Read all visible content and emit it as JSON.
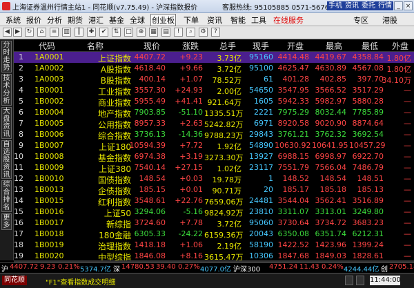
{
  "window": {
    "title": "上海证券温州行情主站1 - 同花顺(v7.75.49) - 沪深指数报价",
    "hotline": "客服热线: 95105885 0571-56768888",
    "top_buttons": [
      "手机",
      "资讯",
      "委托",
      "行情"
    ]
  },
  "menu": {
    "items": [
      "系统",
      "报价",
      "分析",
      "期货",
      "港汇",
      "基金",
      "全球",
      "创业板",
      "下单",
      "资讯",
      "智能",
      "工具",
      "在线服务"
    ],
    "selected": "创业板",
    "highlight": "在线服务",
    "right_items": [
      "专区",
      "港股"
    ]
  },
  "sidebar": {
    "tabs": [
      "分时走势",
      "技术分析",
      "大盘资讯",
      "自选股资讯",
      "综合排名",
      "更多"
    ]
  },
  "table": {
    "headers": [
      "代码",
      "名称",
      "现价",
      "涨跌",
      "总手",
      "现手",
      "开盘",
      "最高",
      "最低",
      "外盘"
    ],
    "rows": [
      {
        "no": "1",
        "code": "1A0001",
        "name": "上证指数",
        "price": "4407.72",
        "chg": "+9.23",
        "vol": "3.73亿",
        "cur": "95160",
        "open": "4414.48",
        "high": "4419.67",
        "low": "4358.84",
        "out": "1.80亿",
        "dir": "up"
      },
      {
        "no": "2",
        "code": "1A0002",
        "name": "A股指数",
        "price": "4618.40",
        "chg": "+9.66",
        "vol": "3.72亿",
        "cur": "95100",
        "open": "4625.47",
        "high": "4630.89",
        "low": "4567.08",
        "out": "1.80亿",
        "dir": "up"
      },
      {
        "no": "3",
        "code": "1A0003",
        "name": "B股指数",
        "price": "400.14",
        "chg": "+1.07",
        "vol": "78.52万",
        "cur": "61",
        "open": "401.28",
        "high": "402.85",
        "low": "397.70",
        "out": "34.10万",
        "dir": "up"
      },
      {
        "no": "4",
        "code": "1B0001",
        "name": "工业指数",
        "price": "3557.30",
        "chg": "+24.93",
        "vol": "2.00亿",
        "cur": "54650",
        "open": "3547.95",
        "high": "3566.52",
        "low": "3517.29",
        "out": "—",
        "dir": "up"
      },
      {
        "no": "5",
        "code": "1B0002",
        "name": "商业指数",
        "price": "5955.49",
        "chg": "+41.41",
        "vol": "921.64万",
        "cur": "1605",
        "open": "5942.33",
        "high": "5982.97",
        "low": "5880.28",
        "out": "—",
        "dir": "up"
      },
      {
        "no": "6",
        "code": "1B0004",
        "name": "地产指数",
        "price": "7903.85",
        "chg": "-51.10",
        "vol": "1335.51万",
        "cur": "2221",
        "open": "7975.29",
        "high": "8032.44",
        "low": "7785.89",
        "out": "—",
        "dir": "dn"
      },
      {
        "no": "7",
        "code": "1B0005",
        "name": "公用指数",
        "price": "8957.33",
        "chg": "+2.63",
        "vol": "5242.82万",
        "cur": "6971",
        "open": "8920.58",
        "high": "9020.90",
        "low": "8874.64",
        "out": "—",
        "dir": "up"
      },
      {
        "no": "8",
        "code": "1B0006",
        "name": "综合指数",
        "price": "3736.13",
        "chg": "-14.36",
        "vol": "9788.23万",
        "cur": "29843",
        "open": "3761.21",
        "high": "3762.32",
        "low": "3692.54",
        "out": "—",
        "dir": "dn"
      },
      {
        "no": "9",
        "code": "1B0007",
        "name": "上证180",
        "price": "10594.39",
        "chg": "+7.72",
        "vol": "1.92亿",
        "cur": "54890",
        "open": "10630.92",
        "high": "10641.95",
        "low": "10457.29",
        "out": "—",
        "dir": "up"
      },
      {
        "no": "10",
        "code": "1B0008",
        "name": "基金指数",
        "price": "6974.38",
        "chg": "+3.19",
        "vol": "3273.30万",
        "cur": "13927",
        "open": "6988.15",
        "high": "6998.97",
        "low": "6922.70",
        "out": "—",
        "dir": "up"
      },
      {
        "no": "11",
        "code": "1B0009",
        "name": "上证380",
        "price": "7540.14",
        "chg": "+27.15",
        "vol": "1.02亿",
        "cur": "23117",
        "open": "7551.79",
        "high": "7566.04",
        "low": "7486.79",
        "out": "—",
        "dir": "up"
      },
      {
        "no": "12",
        "code": "1B0010",
        "name": "国债指数",
        "price": "148.54",
        "chg": "+0.03",
        "vol": "19.78万",
        "cur": "1",
        "open": "148.52",
        "high": "148.54",
        "low": "148.51",
        "out": "—",
        "dir": "up"
      },
      {
        "no": "13",
        "code": "1B0013",
        "name": "企债指数",
        "price": "185.15",
        "chg": "+0.01",
        "vol": "90.71万",
        "cur": "20",
        "open": "185.17",
        "high": "185.18",
        "low": "185.13",
        "out": "—",
        "dir": "up"
      },
      {
        "no": "14",
        "code": "1B0015",
        "name": "红利指数",
        "price": "3548.61",
        "chg": "+22.76",
        "vol": "7659.06万",
        "cur": "24481",
        "open": "3544.04",
        "high": "3562.41",
        "low": "3516.89",
        "out": "—",
        "dir": "up"
      },
      {
        "no": "15",
        "code": "1B0016",
        "name": "上证50",
        "price": "3294.06",
        "chg": "-5.16",
        "vol": "9824.92万",
        "cur": "23810",
        "open": "3311.07",
        "high": "3313.01",
        "low": "3249.80",
        "out": "—",
        "dir": "dn"
      },
      {
        "no": "16",
        "code": "1B0017",
        "name": "新综指",
        "price": "3724.60",
        "chg": "+7.78",
        "vol": "3.72亿",
        "cur": "95060",
        "open": "3730.64",
        "high": "3734.72",
        "low": "3683.23",
        "out": "—",
        "dir": "up"
      },
      {
        "no": "17",
        "code": "1B0018",
        "name": "180金融",
        "price": "6305.33",
        "chg": "-24.22",
        "vol": "6159.36万",
        "cur": "20043",
        "open": "6350.08",
        "high": "6351.74",
        "low": "6212.31",
        "out": "—",
        "dir": "dn"
      },
      {
        "no": "18",
        "code": "1B0019",
        "name": "治理指数",
        "price": "1418.18",
        "chg": "+1.06",
        "vol": "2.19亿",
        "cur": "58190",
        "open": "1422.52",
        "high": "1423.96",
        "low": "1399.24",
        "out": "—",
        "dir": "up"
      },
      {
        "no": "19",
        "code": "1B0020",
        "name": "中型综指",
        "price": "1846.08",
        "chg": "+8.16",
        "vol": "3615.47万",
        "cur": "10306",
        "open": "1847.68",
        "high": "1849.03",
        "low": "1828.61",
        "out": "—",
        "dir": "up"
      }
    ]
  },
  "ticker": {
    "items": [
      {
        "label": "沪",
        "value": "4407.72",
        "chg": "9.23",
        "pct": "0.21%",
        "amt": "5374.7亿",
        "dir": "up"
      },
      {
        "label": "深",
        "value": "14780.53",
        "chg": "39.40",
        "pct": "0.27%",
        "amt": "4077.0亿",
        "dir": "up"
      },
      {
        "label": "沪深300",
        "value": "4751.24",
        "chg": "11.43",
        "pct": "0.24%",
        "amt": "4244.44亿",
        "dir": "up"
      },
      {
        "label": "创",
        "value": "2705.18",
        "chg": "70.22",
        "pct": "2.67%",
        "amt": "",
        "dir": "up"
      }
    ]
  },
  "status": {
    "logo": "同花顺",
    "hint": "\"F1\"查看指数成交明细",
    "clock": "11:44:00"
  }
}
